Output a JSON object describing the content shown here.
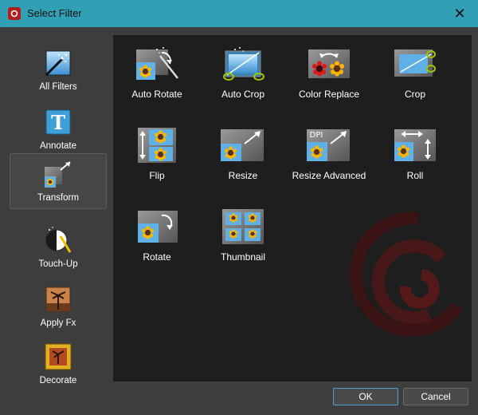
{
  "window": {
    "title": "Select Filter",
    "close_glyph": "✕",
    "accent": "#31a0b5"
  },
  "sidebar": {
    "items": [
      {
        "label": "All Filters",
        "icon": "all-filters-icon",
        "selected": false
      },
      {
        "label": "Annotate",
        "icon": "annotate-icon",
        "selected": false
      },
      {
        "label": "Transform",
        "icon": "transform-icon",
        "selected": true
      },
      {
        "label": "Touch-Up",
        "icon": "touch-up-icon",
        "selected": false
      },
      {
        "label": "Apply Fx",
        "icon": "apply-fx-icon",
        "selected": false
      },
      {
        "label": "Decorate",
        "icon": "decorate-icon",
        "selected": false
      }
    ],
    "annotate_glyph": "T"
  },
  "filters": [
    {
      "label": "Auto Rotate",
      "icon": "auto-rotate-icon"
    },
    {
      "label": "Auto Crop",
      "icon": "auto-crop-icon"
    },
    {
      "label": "Color Replace",
      "icon": "color-replace-icon"
    },
    {
      "label": "Crop",
      "icon": "crop-icon"
    },
    {
      "label": "Flip",
      "icon": "flip-icon"
    },
    {
      "label": "Resize",
      "icon": "resize-icon"
    },
    {
      "label": "Resize Advanced",
      "icon": "resize-advanced-icon"
    },
    {
      "label": "Roll",
      "icon": "roll-icon"
    },
    {
      "label": "Rotate",
      "icon": "rotate-icon"
    },
    {
      "label": "Thumbnail",
      "icon": "thumbnail-icon"
    }
  ],
  "resize_advanced_badge": "DPI",
  "buttons": {
    "ok": "OK",
    "cancel": "Cancel"
  }
}
